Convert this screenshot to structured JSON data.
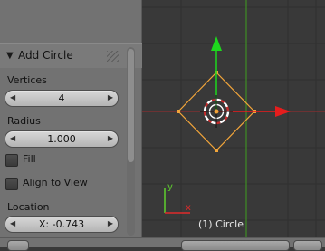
{
  "operator_panel": {
    "title": "Add Circle",
    "vertices": {
      "label": "Vertices",
      "value": "4"
    },
    "radius": {
      "label": "Radius",
      "value": "1.000"
    },
    "fill": {
      "label": "Fill",
      "checked": false
    },
    "align_to_view": {
      "label": "Align to View",
      "checked": false
    },
    "location": {
      "label": "Location",
      "x_value": "X: -0.743"
    }
  },
  "viewport": {
    "object_label": "(1) Circle",
    "mini_axis": {
      "y_label": "y",
      "x_label": "x"
    },
    "colors": {
      "background": "#393939",
      "grid_line": "#2f2f2f",
      "x_axis": "#c0393b",
      "y_axis": "#5fae2e",
      "selection": "#f2a53a",
      "gizmo_x": "#e51d1d",
      "gizmo_y": "#1ed81e"
    }
  },
  "icons": {
    "panel_collapse": "triangle-down-icon",
    "panel_grip": "drag-grip-icon",
    "field_arrows": "chevron-left-right-icon"
  }
}
